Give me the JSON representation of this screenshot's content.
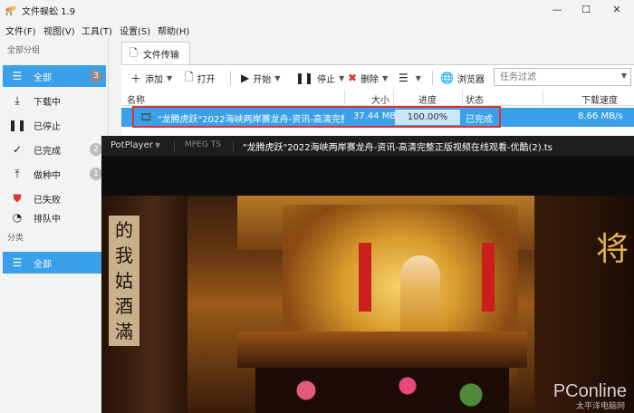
{
  "window": {
    "title": "文件蜈蚣 1.9",
    "minimize": "—",
    "maximize": "☐",
    "close": "✕"
  },
  "menu": [
    "文件(F)",
    "视图(V)",
    "工具(T)",
    "设置(S)",
    "帮助(H)"
  ],
  "sidebar": {
    "section_all": "全部分组",
    "items": [
      {
        "label": "全部",
        "icon": "list-icon",
        "count": "3"
      },
      {
        "label": "下载中",
        "icon": "download-icon"
      },
      {
        "label": "已停止",
        "icon": "pause-icon"
      },
      {
        "label": "已完成",
        "icon": "check-icon",
        "count": "2"
      },
      {
        "label": "做种中",
        "icon": "upload-icon",
        "count": "1"
      },
      {
        "label": "已失败",
        "icon": "warning-icon"
      },
      {
        "label": "排队中",
        "icon": "queue-icon"
      }
    ],
    "section_category": "分类",
    "category_items": [
      {
        "label": "全部",
        "icon": "list-icon"
      }
    ]
  },
  "tab": {
    "label": "文件传输",
    "icon": "file-icon"
  },
  "toolbar": {
    "add": "添加",
    "open": "打开",
    "start": "开始",
    "stop": "停止",
    "delete": "删除",
    "browser": "浏览器",
    "filter_placeholder": "任务过滤"
  },
  "table": {
    "columns": [
      "名称",
      "大小",
      "进度",
      "状态",
      "下载速度"
    ],
    "rows": [
      {
        "name": "\"龙腾虎跃\"2022海峡两岸赛龙舟-资讯-高清完整...",
        "size": "37.44 MB",
        "progress": "100.00%",
        "progress_value": 1.0,
        "status": "已完成",
        "speed": "8.66 MB/s"
      }
    ]
  },
  "player": {
    "app": "PotPlayer",
    "format": "MPEG TS",
    "title": "\"龙腾虎跃\"2022海峡两岸赛龙舟-资讯-高清完整正版视频在线观看-优酷(2).ts",
    "calligraphy_left": "的我姑酒滿",
    "calligraphy_right": "将",
    "watermark": "PConline",
    "watermark_sub": "太平洋电脑网"
  },
  "colors": {
    "accent": "#3aa0e9",
    "highlight_border": "#e03030"
  }
}
